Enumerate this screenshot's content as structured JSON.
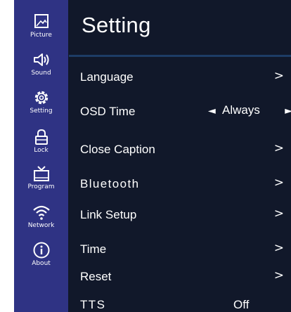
{
  "sidebar": {
    "items": [
      {
        "label": "Picture",
        "icon": "picture-icon"
      },
      {
        "label": "Sound",
        "icon": "speaker-icon"
      },
      {
        "label": "Setting",
        "icon": "gear-icon"
      },
      {
        "label": "Lock",
        "icon": "lock-icon"
      },
      {
        "label": "Program",
        "icon": "tv-antenna-icon"
      },
      {
        "label": "Network",
        "icon": "wifi-icon"
      },
      {
        "label": "About",
        "icon": "info-icon"
      }
    ]
  },
  "main": {
    "title": "Setting",
    "menu": [
      {
        "label": "Language",
        "arrow": ">"
      },
      {
        "label": "OSD Time",
        "value": "Always",
        "left_arrow": "◄",
        "right_arrow": "►"
      },
      {
        "label": "Close Caption",
        "arrow": ">"
      },
      {
        "label": "Bluetooth",
        "arrow": ">"
      },
      {
        "label": "Link Setup",
        "arrow": ">"
      },
      {
        "label": "Time",
        "arrow": ">"
      },
      {
        "label": "Reset",
        "arrow": ">"
      },
      {
        "label": "TTS",
        "value": "Off"
      }
    ]
  },
  "colors": {
    "sidebar_bg": "#2f3384",
    "panel_bg": "#11182a",
    "divider": "#1d3c66",
    "text": "#ffffff"
  }
}
